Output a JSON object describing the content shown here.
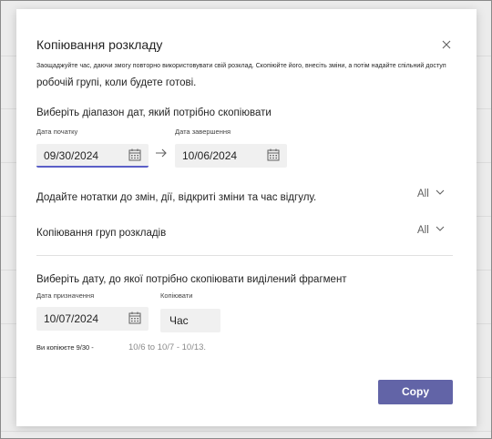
{
  "dialog": {
    "title": "Копіювання розкладу",
    "description_line1": "Заощаджуйте час, даючи змогу  повторно використовувати свій розклад. Скопіюйте його, внесіть зміни,  а потім надайте спільний доступ",
    "description_line2": "робочій групі, коли будете готові."
  },
  "date_range": {
    "heading": "Виберіть діапазон дат, який потрібно скопіювати",
    "start_label": "Дата початку",
    "start_value": "09/30/2024",
    "end_label": "Дата завершення",
    "end_value": "10/06/2024"
  },
  "notes": {
    "label": "Додайте нотатки до змін, дії, відкриті зміни та час відгулу.",
    "selector": "All"
  },
  "groups": {
    "label": "Копіювання груп розкладів",
    "selector": "All"
  },
  "target": {
    "heading": "Виберіть дату, до якої потрібно скопіювати виділений фрагмент",
    "date_label": "Дата призначення",
    "date_value": "10/07/2024",
    "copy_label": "Копіювати",
    "copy_value": "Час",
    "summary_prefix": "Ви копіюєте 9/30 -",
    "summary_range": "10/6 to 10/7 - 10/13."
  },
  "actions": {
    "copy_button": "Copy"
  },
  "colors": {
    "accent": "#6264a7",
    "focus": "#5b5fc7"
  },
  "icons": [
    "close-icon",
    "calendar-icon",
    "arrow-right-icon",
    "chevron-down-icon"
  ]
}
